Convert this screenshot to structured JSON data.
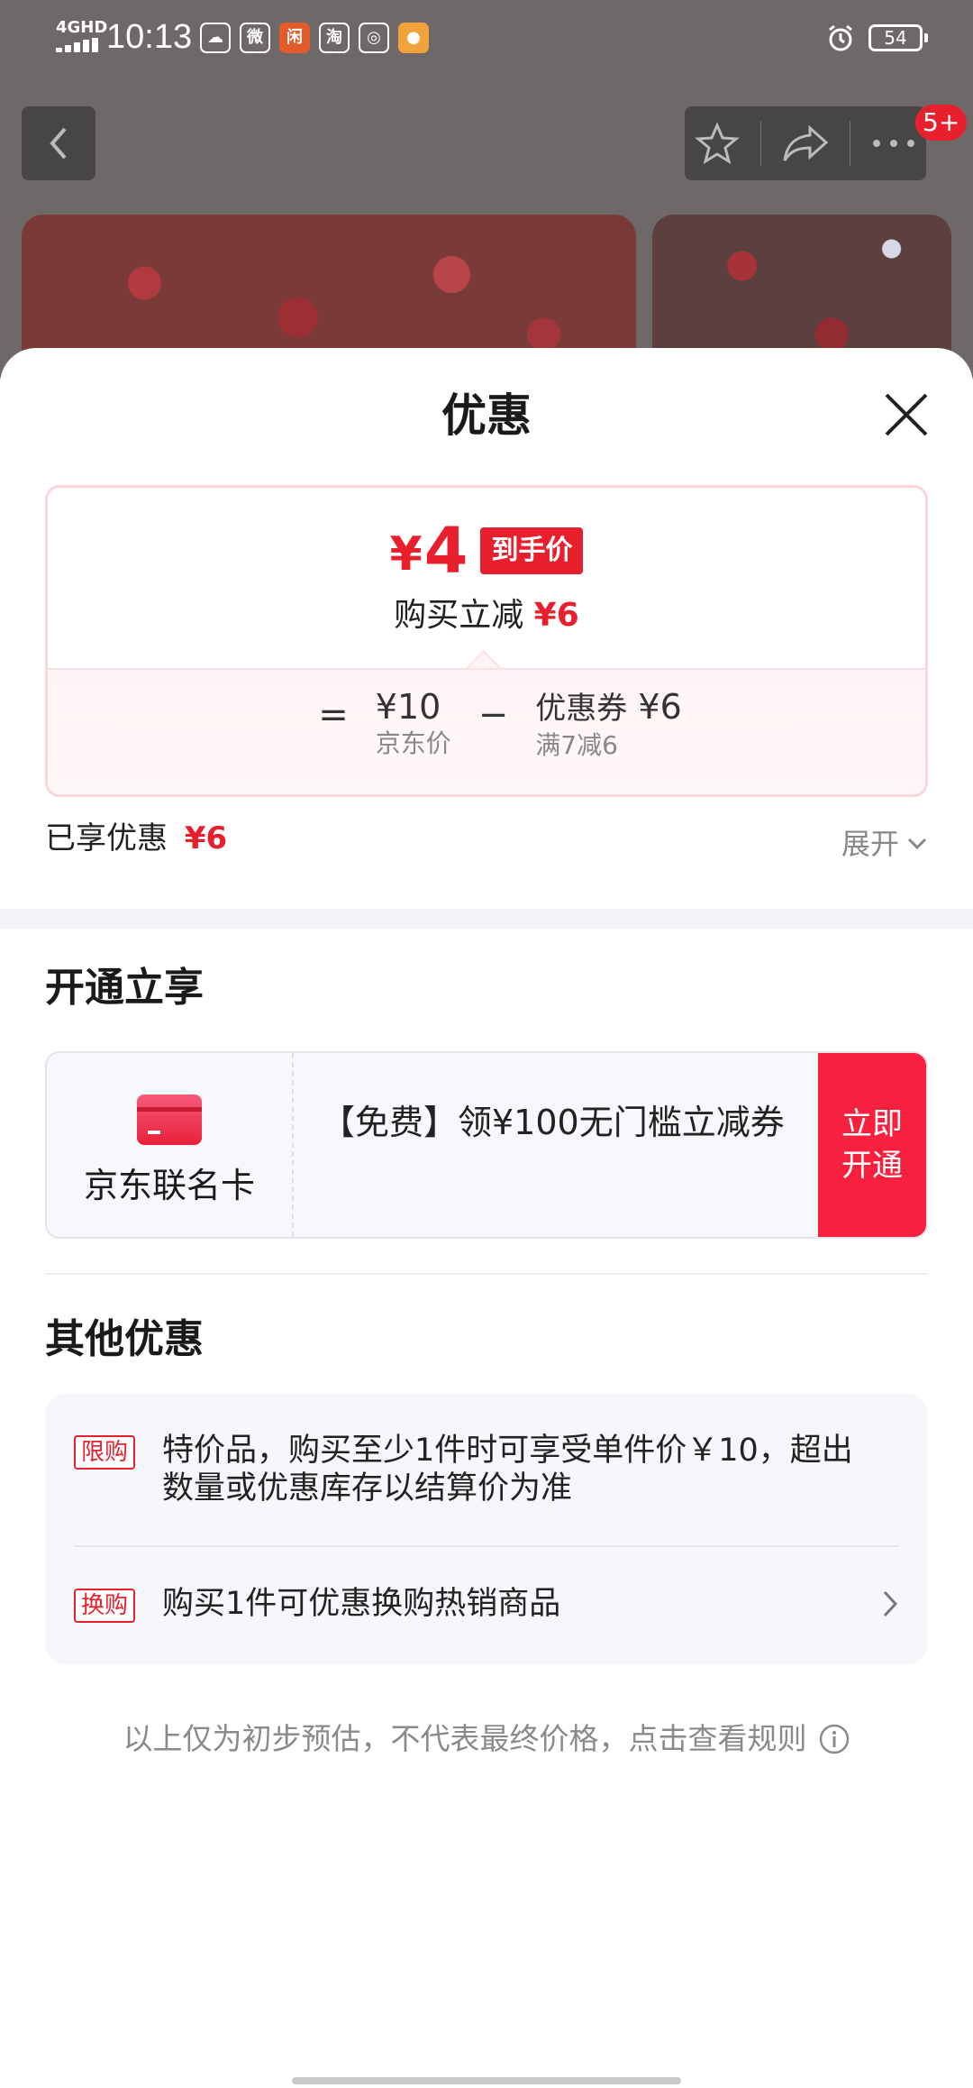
{
  "status_bar": {
    "network": "4GHD",
    "time": "10:13",
    "app_icons": [
      {
        "name": "weather-cloud-icon",
        "glyph": "☁",
        "color": "#ffffff"
      },
      {
        "name": "weibo-icon",
        "glyph": "微",
        "color": "#ffffff"
      },
      {
        "name": "app-xian-icon",
        "glyph": "闲",
        "color": "#e35a2b"
      },
      {
        "name": "taobao-icon",
        "glyph": "淘",
        "color": "#ffffff"
      },
      {
        "name": "app-circle-icon",
        "glyph": "◎",
        "color": "#ffffff"
      },
      {
        "name": "app-yellow-icon",
        "glyph": "●",
        "color": "#f2a23a"
      }
    ],
    "battery": "54"
  },
  "top_nav": {
    "badge": "5+"
  },
  "sheet": {
    "title": "优惠",
    "final_price": {
      "currency": "¥",
      "amount": "4",
      "tag": "到手价"
    },
    "reduce": {
      "label": "购买立减",
      "amount": "¥6"
    },
    "formula": {
      "equals": "=",
      "minus": "−",
      "jd_price": {
        "value": "¥10",
        "label": "京东价"
      },
      "coupon": {
        "label": "优惠券",
        "value": "¥6",
        "sub": "满7减6"
      }
    },
    "enjoyed": {
      "label": "已享优惠",
      "amount": "¥6"
    },
    "expand_label": "展开"
  },
  "open_section": {
    "title": "开通立享",
    "card_name": "京东联名卡",
    "description": "【免费】领¥100无门槛立减券",
    "button_label": "立即开通"
  },
  "other_section": {
    "title": "其他优惠",
    "items": [
      {
        "badge": "限购",
        "text": "特价品，购买至少1件时可享受单件价￥10，超出数量或优惠库存以结算价为准"
      },
      {
        "badge": "换购",
        "text": "购买1件可优惠换购热销商品"
      }
    ]
  },
  "footer_note": "以上仅为初步预估，不代表最终价格，点击查看规则",
  "colors": {
    "accent_red": "#e8202e",
    "muted_text": "#8a8a8a",
    "section_bg": "#f4f5fa"
  }
}
